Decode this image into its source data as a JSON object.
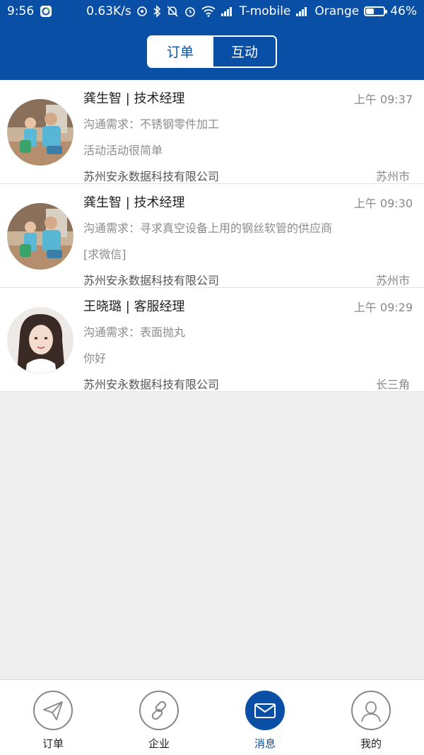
{
  "status_bar": {
    "time": "9:56",
    "speed": "0.63K/s",
    "carrier1": "T-mobile",
    "carrier2": "Orange",
    "battery": "46%",
    "battery_level": 0.46,
    "icons": [
      "app-icon",
      "eye-icon",
      "bluetooth-icon",
      "mute-bell-icon",
      "alarm-icon",
      "wifi-icon",
      "signal-icon",
      "signal-icon",
      "battery-icon"
    ]
  },
  "header": {
    "tabs": [
      {
        "label": "订单",
        "active": true
      },
      {
        "label": "互动",
        "active": false
      }
    ]
  },
  "messages": [
    {
      "name": "龚生智 | 技术经理",
      "time": "上午 09:37",
      "demand": "沟通需求：不锈钢零件加工",
      "text": "活动活动很简单",
      "company": "苏州安永数据科技有限公司",
      "city": "苏州市",
      "avatar": "family-photo"
    },
    {
      "name": "龚生智 | 技术经理",
      "time": "上午 09:30",
      "demand": "沟通需求：寻求真空设备上用的钢丝软管的供应商",
      "text": "[求微信]",
      "company": "苏州安永数据科技有限公司",
      "city": "苏州市",
      "avatar": "family-photo"
    },
    {
      "name": "王晓璐 | 客服经理",
      "time": "上午 09:29",
      "demand": "沟通需求：表面抛丸",
      "text": "你好",
      "company": "苏州安永数据科技有限公司",
      "city": "长三角",
      "avatar": "woman-photo"
    }
  ],
  "bottom_nav": [
    {
      "label": "订单",
      "icon": "paper-plane-icon",
      "active": false
    },
    {
      "label": "企业",
      "icon": "link-icon",
      "active": false
    },
    {
      "label": "消息",
      "icon": "envelope-icon",
      "active": true
    },
    {
      "label": "我的",
      "icon": "user-icon",
      "active": false
    }
  ],
  "colors": {
    "brand_blue": "#0a4fa6",
    "background": "#efefef",
    "muted_text": "#8c8c8c"
  }
}
